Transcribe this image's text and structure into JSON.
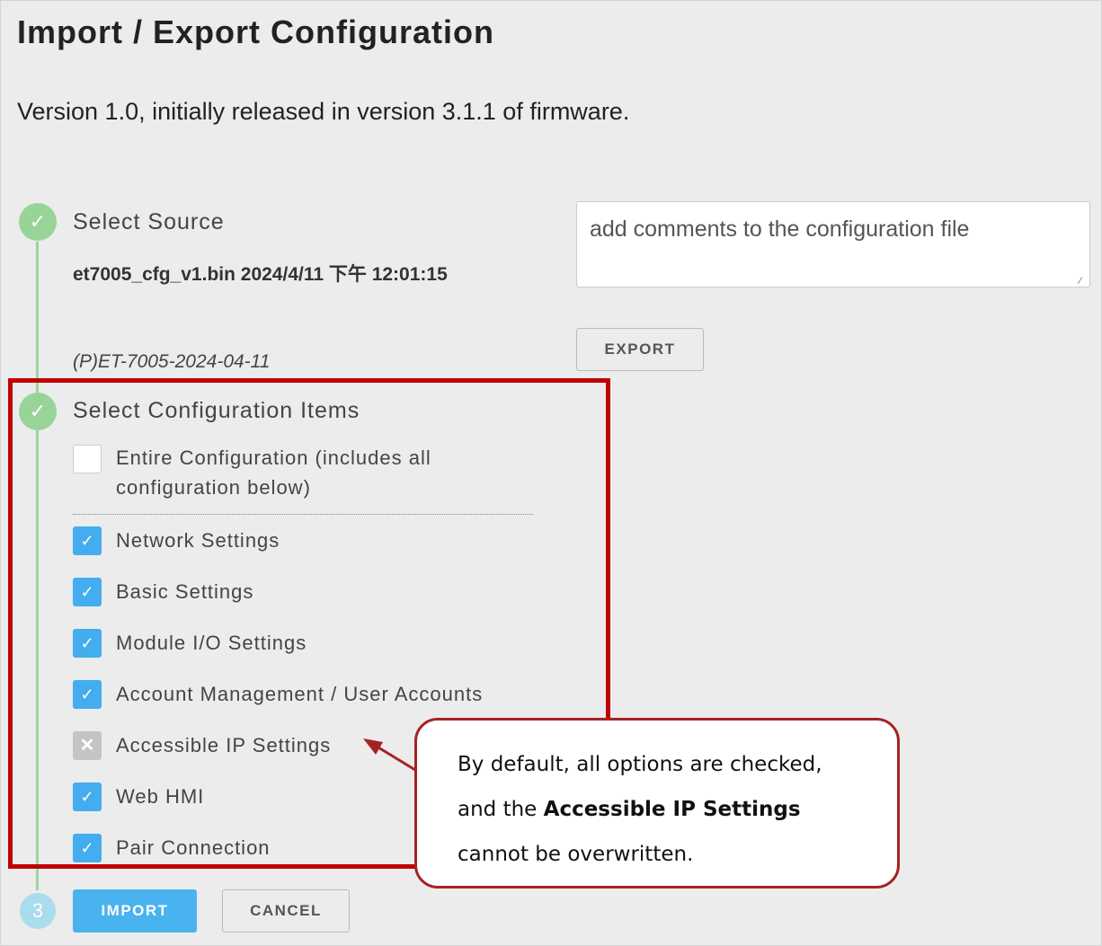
{
  "page": {
    "title": "Import / Export Configuration",
    "version_text": "Version 1.0, initially released in version 3.1.1 of firmware."
  },
  "steps": [
    {
      "marker": "✓",
      "title": "Select Source",
      "status": "done"
    },
    {
      "marker": "✓",
      "title": "Select Configuration Items",
      "status": "done"
    },
    {
      "marker": "3",
      "title": "",
      "status": "current"
    }
  ],
  "source": {
    "file": "et7005_cfg_v1.bin 2024/4/11 下午 12:01:15",
    "tag": "(P)ET-7005-2024-04-11"
  },
  "comments": {
    "placeholder": "add comments to the configuration file",
    "value": ""
  },
  "buttons": {
    "export": "EXPORT",
    "import": "IMPORT",
    "cancel": "CANCEL"
  },
  "config_items": {
    "entire": {
      "label": "Entire Configuration (includes all configuration below)",
      "checked": false
    },
    "items": [
      {
        "label": "Network Settings",
        "state": "checked",
        "mark": "✓"
      },
      {
        "label": "Basic Settings",
        "state": "checked",
        "mark": "✓"
      },
      {
        "label": "Module I/O Settings",
        "state": "checked",
        "mark": "✓"
      },
      {
        "label": "Account Management / User Accounts",
        "state": "checked",
        "mark": "✓"
      },
      {
        "label": "Accessible IP Settings",
        "state": "disabled",
        "mark": "✕"
      },
      {
        "label": "Web HMI",
        "state": "checked",
        "mark": "✓"
      },
      {
        "label": "Pair Connection",
        "state": "checked",
        "mark": "✓"
      }
    ]
  },
  "callout": {
    "line1": "By default, all options are checked,",
    "line2_prefix": "and the ",
    "line2_bold": "Accessible IP Settings",
    "line3": "cannot be overwritten."
  },
  "colors": {
    "step_done": "#98d498",
    "step_current": "#a9dcec",
    "checkbox_checked": "#43adef",
    "primary_button": "#48b3ee",
    "annotation_red": "#c00000"
  }
}
